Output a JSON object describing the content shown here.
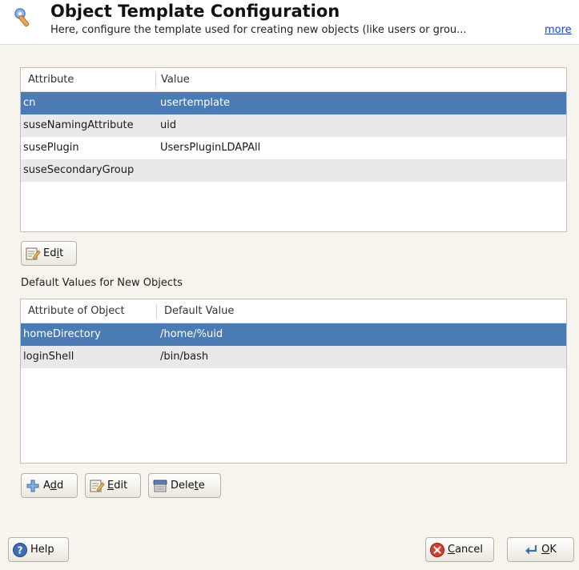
{
  "header": {
    "title": "Object Template Configuration",
    "subtitle": "Here, configure the template used for creating new objects (like users or grou...",
    "more_link": "more",
    "icon": "wrench-icon"
  },
  "template_table": {
    "columns": [
      "Attribute",
      "Value"
    ],
    "rows": [
      {
        "attribute": "cn",
        "value": "usertemplate",
        "selected": true
      },
      {
        "attribute": "suseNamingAttribute",
        "value": "uid"
      },
      {
        "attribute": "susePlugin",
        "value": "UsersPluginLDAPAll"
      },
      {
        "attribute": "suseSecondaryGroup",
        "value": ""
      }
    ]
  },
  "edit_button_1": {
    "label_pre": "Ed",
    "mnemonic": "i",
    "label_post": "t",
    "icon": "edit-icon"
  },
  "defaults_section": {
    "label": "Default Values for New Objects"
  },
  "defaults_table": {
    "columns": [
      "Attribute of Object",
      "Default Value"
    ],
    "rows": [
      {
        "attribute": "homeDirectory",
        "value": "/home/%uid",
        "selected": true
      },
      {
        "attribute": "loginShell",
        "value": "/bin/bash"
      }
    ]
  },
  "add_button": {
    "label_pre": "A",
    "mnemonic": "d",
    "label_post": "d",
    "icon": "add-icon"
  },
  "edit_button_2": {
    "label_pre": "",
    "mnemonic": "E",
    "label_post": "dit",
    "icon": "edit-icon"
  },
  "delete_button": {
    "label_pre": "Dele",
    "mnemonic": "t",
    "label_post": "e",
    "icon": "delete-icon"
  },
  "help_button": {
    "label": "Help",
    "icon": "help-icon"
  },
  "cancel_button": {
    "label_pre": "",
    "mnemonic": "C",
    "label_post": "ancel",
    "icon": "cancel-icon"
  },
  "ok_button": {
    "label_pre": "",
    "mnemonic": "O",
    "label_post": "K",
    "icon": "ok-arrow-icon"
  },
  "colors": {
    "selection": "#4a7bb5",
    "alt_row": "#e9e9e9",
    "background": "#f7f3ed",
    "link": "#1a3fd8"
  }
}
